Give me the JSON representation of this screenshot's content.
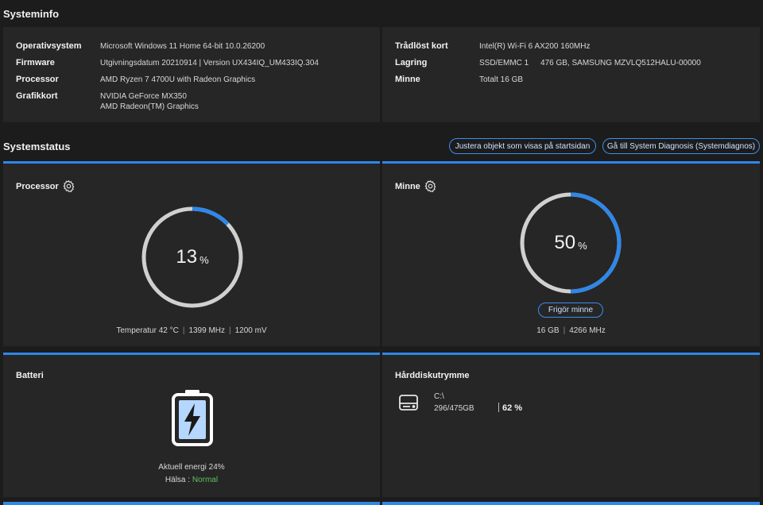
{
  "systeminfo": {
    "title": "Systeminfo",
    "left": [
      {
        "label": "Operativsystem",
        "value": "Microsoft Windows 11 Home 64-bit 10.0.26200"
      },
      {
        "label": "Firmware",
        "value": "Utgivningsdatum 20210914 | Version UX434IQ_UM433IQ.304"
      },
      {
        "label": "Processor",
        "value": "AMD Ryzen 7 4700U with Radeon Graphics"
      },
      {
        "label": "Grafikkort",
        "value": "NVIDIA GeForce MX350",
        "value2": "AMD Radeon(TM) Graphics"
      }
    ],
    "right": [
      {
        "label": "Trådlöst kort",
        "value": "Intel(R) Wi-Fi 6 AX200 160MHz"
      },
      {
        "label": "Lagring",
        "value": "SSD/EMMC 1",
        "value2": "476 GB, SAMSUNG MZVLQ512HALU-00000"
      },
      {
        "label": "Minne",
        "value": "Totalt 16 GB"
      }
    ]
  },
  "systemstatus": {
    "title": "Systemstatus",
    "adjust_button": "Justera objekt som visas på startsidan",
    "diagnosis_button": "Gå till System Diagnosis (Systemdiagnos)"
  },
  "processor": {
    "title": "Processor",
    "percent": "13",
    "percent_value": 13,
    "unit": "%",
    "temp": "Temperatur 42 °C",
    "freq": "1399 MHz",
    "voltage": "1200 mV"
  },
  "memory": {
    "title": "Minne",
    "percent": "50",
    "percent_value": 50,
    "unit": "%",
    "free_button": "Frigör minne",
    "size": "16 GB",
    "freq": "4266 MHz"
  },
  "battery": {
    "title": "Batteri",
    "energy": "Aktuell energi 24%",
    "health_label": "Hälsa :",
    "health_value": "Normal"
  },
  "disk": {
    "title": "Hårddiskutrymme",
    "drive": "C:\\",
    "usage": "296/475GB",
    "percent": "62 %"
  },
  "colors": {
    "accent": "#2f87e8",
    "track": "#d0d0d0",
    "good": "#5fbf5f"
  },
  "icons": [
    "gear-icon",
    "battery-charging-icon",
    "hard-drive-icon"
  ]
}
